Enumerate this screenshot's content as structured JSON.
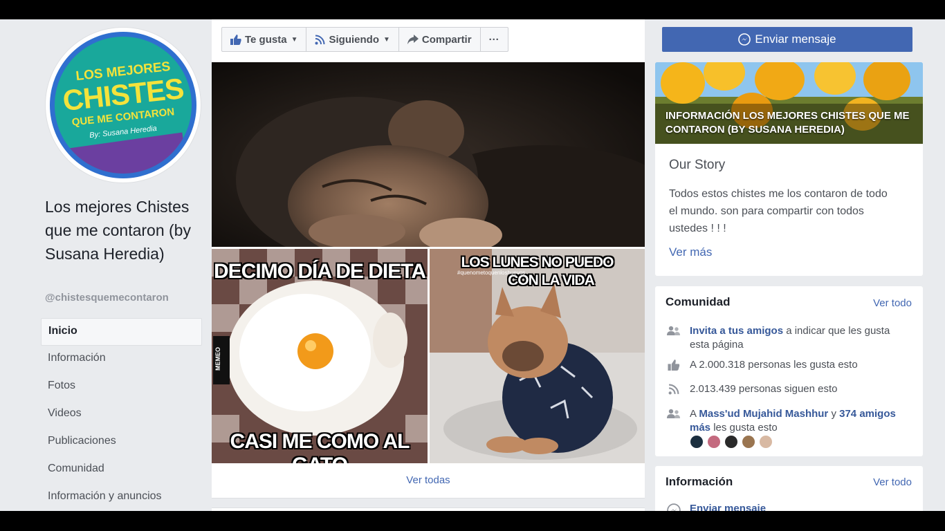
{
  "page": {
    "logo": {
      "line1": "LOS MEJORES",
      "line2": "CHISTES",
      "line3": "QUE ME CONTARON",
      "line4": "By: Susana Heredia"
    },
    "name": "Los mejores Chistes que me contaron (by Susana Heredia)",
    "handle": "@chistesquemecontaron"
  },
  "nav": [
    {
      "label": "Inicio",
      "active": true
    },
    {
      "label": "Información"
    },
    {
      "label": "Fotos"
    },
    {
      "label": "Videos"
    },
    {
      "label": "Publicaciones"
    },
    {
      "label": "Comunidad"
    },
    {
      "label": "Información y anuncios"
    }
  ],
  "actions": {
    "like": "Te gusta",
    "follow": "Siguiendo",
    "share": "Compartir",
    "more": "···"
  },
  "message_button": "Enviar mensaje",
  "photos": {
    "meme1": {
      "top": "DECIMO DÍA DE DIETA",
      "bottom": "CASI ME COMO AL GATO",
      "watermark": "MEMEO"
    },
    "meme2": {
      "top1": "LOS LUNES NO PUEDO",
      "top2": "CON LA VIDA",
      "hashtag": "#quenometoquenloshuevos"
    },
    "see_all": "Ver todas"
  },
  "about": {
    "banner_title": "INFORMACIÓN LOS MEJORES CHISTES QUE ME CONTARON (BY SUSANA HEREDIA)",
    "story_title": "Our Story",
    "story_text": "Todos estos chistes me los contaron de todo el mundo. son para compartir con todos ustedes ! ! !",
    "see_more": "Ver más"
  },
  "community": {
    "title": "Comunidad",
    "see_all": "Ver todo",
    "invite_link": "Invita a tus amigos",
    "invite_rest": " a indicar que les gusta esta página",
    "likes": "A 2.000.318 personas les gusta esto",
    "follows": "2.013.439 personas siguen esto",
    "friends_prefix": "A ",
    "friend_name": "Mass'ud Mujahid Mashhur",
    "friends_mid": " y ",
    "friends_count": "374 amigos más",
    "friends_suffix": " les gusta esto",
    "face_colors": [
      "#1c2f3f",
      "#c46a7f",
      "#2a2a2a",
      "#9a7550",
      "#d8b9a3"
    ]
  },
  "info": {
    "title": "Información",
    "see_all": "Ver todo",
    "send_message": "Enviar mensaje"
  },
  "colors": {
    "facebook_blue": "#4267b2",
    "link": "#365899",
    "background": "#e9ebee"
  }
}
